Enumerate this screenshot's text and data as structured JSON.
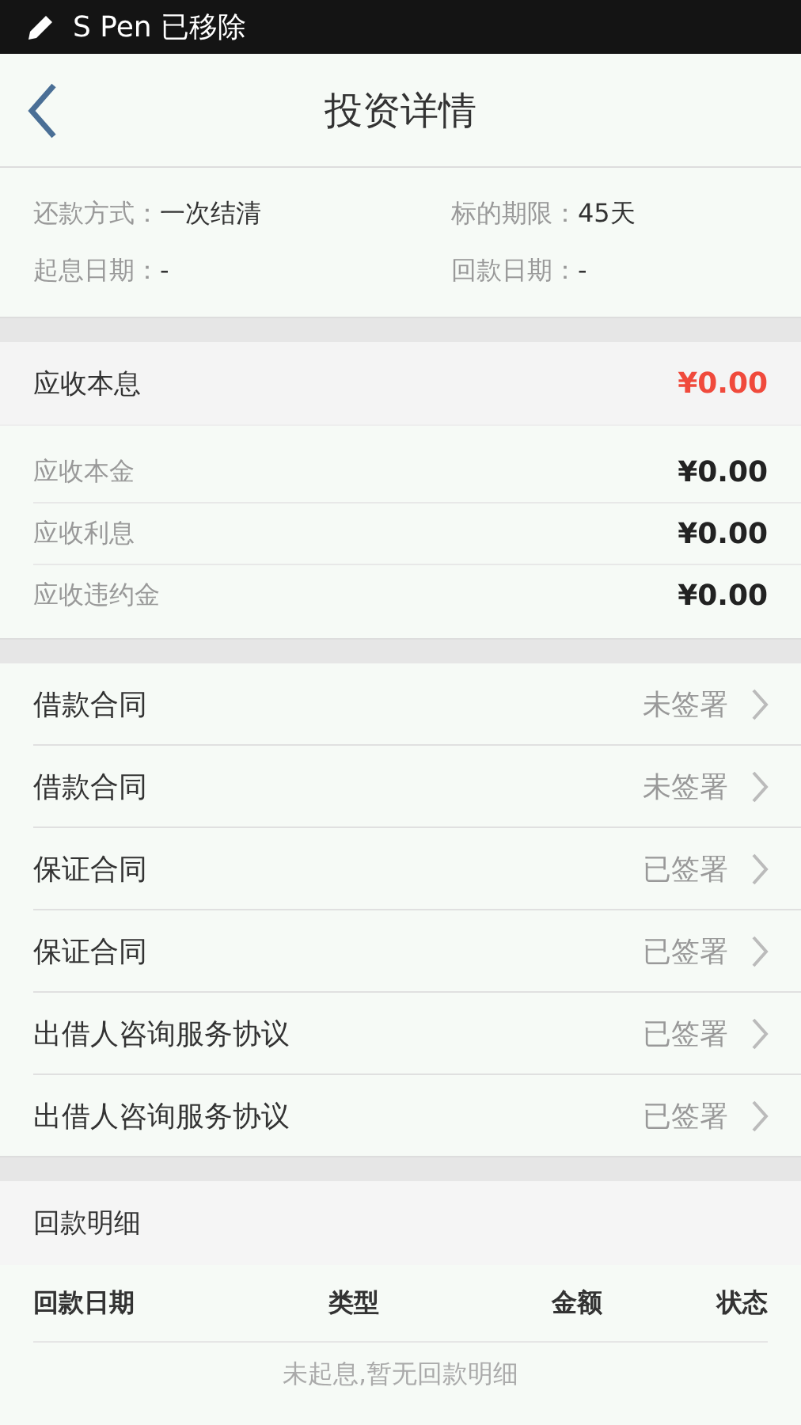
{
  "status_bar": {
    "text": "S Pen 已移除"
  },
  "header": {
    "title": "投资详情"
  },
  "info": [
    [
      {
        "label": "还款方式：",
        "value": "一次结清"
      },
      {
        "label": "标的期限：",
        "value": "45天"
      }
    ],
    [
      {
        "label": "起息日期：",
        "value": "-"
      },
      {
        "label": "回款日期：",
        "value": "-"
      }
    ]
  ],
  "receivable": {
    "label": "应收本息",
    "amount": "¥0.00",
    "items": [
      {
        "label": "应收本金",
        "amount": "¥0.00"
      },
      {
        "label": "应收利息",
        "amount": "¥0.00"
      },
      {
        "label": "应收违约金",
        "amount": "¥0.00"
      }
    ]
  },
  "contracts": [
    {
      "name": "借款合同",
      "status": "未签署"
    },
    {
      "name": "借款合同",
      "status": "未签署"
    },
    {
      "name": "保证合同",
      "status": "已签署"
    },
    {
      "name": "保证合同",
      "status": "已签署"
    },
    {
      "name": "出借人咨询服务协议",
      "status": "已签署"
    },
    {
      "name": "出借人咨询服务协议",
      "status": "已签署"
    }
  ],
  "repayment": {
    "title": "回款明细",
    "columns": [
      "回款日期",
      "类型",
      "金额",
      "状态"
    ],
    "empty_text": "未起息,暂无回款明细"
  }
}
